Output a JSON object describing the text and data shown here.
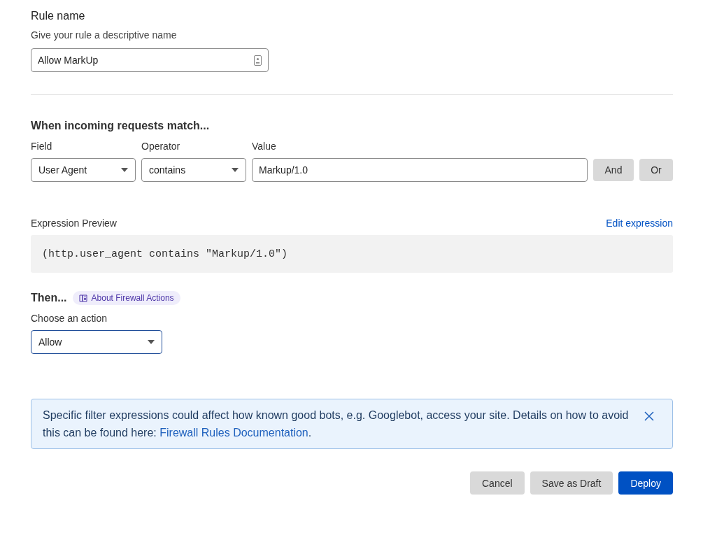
{
  "rule_name": {
    "label": "Rule name",
    "hint": "Give your rule a descriptive name",
    "value": "Allow MarkUp"
  },
  "match": {
    "heading": "When incoming requests match...",
    "field": {
      "label": "Field",
      "value": "User Agent",
      "focused": false
    },
    "operator": {
      "label": "Operator",
      "value": "contains",
      "focused": false
    },
    "value": {
      "label": "Value",
      "value": "Markup/1.0"
    },
    "buttons": [
      "And",
      "Or"
    ]
  },
  "preview": {
    "label": "Expression Preview",
    "link": "Edit expression",
    "expression": "(http.user_agent contains \"Markup/1.0\")"
  },
  "then": {
    "heading": "Then...",
    "badge": "About Firewall Actions",
    "label": "Choose an action",
    "action": {
      "value": "Allow",
      "focused": true
    }
  },
  "alert": {
    "text_before": "Specific filter expressions could affect how known good bots, e.g. Googlebot, access your site. Details on how to avoid this can be found here: ",
    "link": "Firewall Rules Documentation",
    "text_after": "."
  },
  "footer_buttons": [
    {
      "label": "Cancel",
      "kind": "secondary"
    },
    {
      "label": "Save as Draft",
      "kind": "secondary"
    },
    {
      "label": "Deploy",
      "kind": "primary"
    }
  ]
}
